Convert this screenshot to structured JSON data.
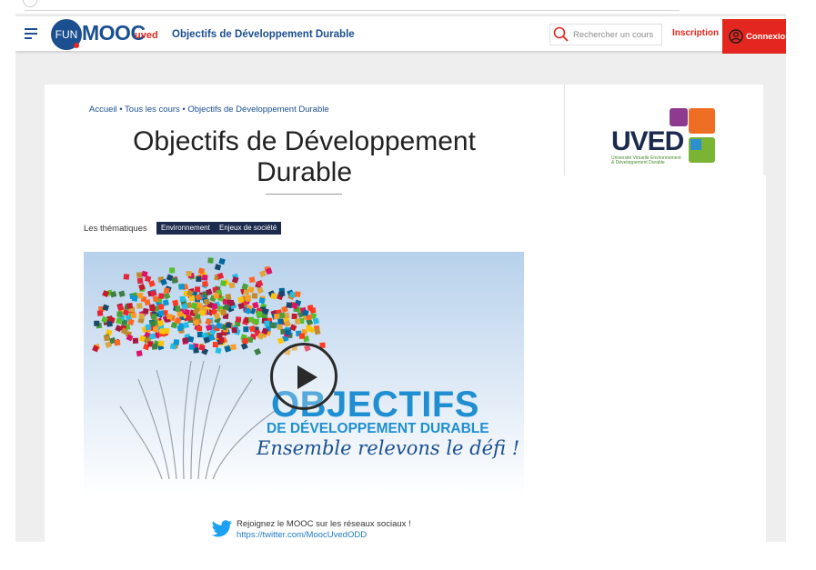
{
  "header": {
    "logo_fun": "FUN",
    "logo_mooc": "MOOC",
    "org": "uved",
    "course": "Objectifs de Développement Durable",
    "search_placeholder": "Rechercher un cours",
    "signup": "Inscription",
    "login": "Connexion"
  },
  "breadcrumb": "Accueil • Tous les cours • Objectifs de Développement Durable",
  "title": "Objectifs de Développement Durable",
  "themes": {
    "label": "Les thématiques",
    "tags": [
      "Environnement",
      "Enjeux de société"
    ]
  },
  "video": {
    "headline": "OBJECTIFS",
    "subline": "DE DÉVELOPPEMENT DURABLE",
    "tagline": "Ensemble relevons le défi !"
  },
  "social": {
    "text": "Rejoignez le MOOC sur les réseaux sociaux !",
    "link": "https://twitter.com/MoocUvedODD"
  },
  "partner_logo": {
    "name": "UVED",
    "caption_1": "Université Virtuelle Environnement",
    "caption_2": "& Développement Durable"
  },
  "colors": {
    "brand_blue": "#1b4f8f",
    "brand_red": "#e3261f",
    "tag_bg": "#1c2a4d",
    "link_blue": "#1f7ac4"
  }
}
